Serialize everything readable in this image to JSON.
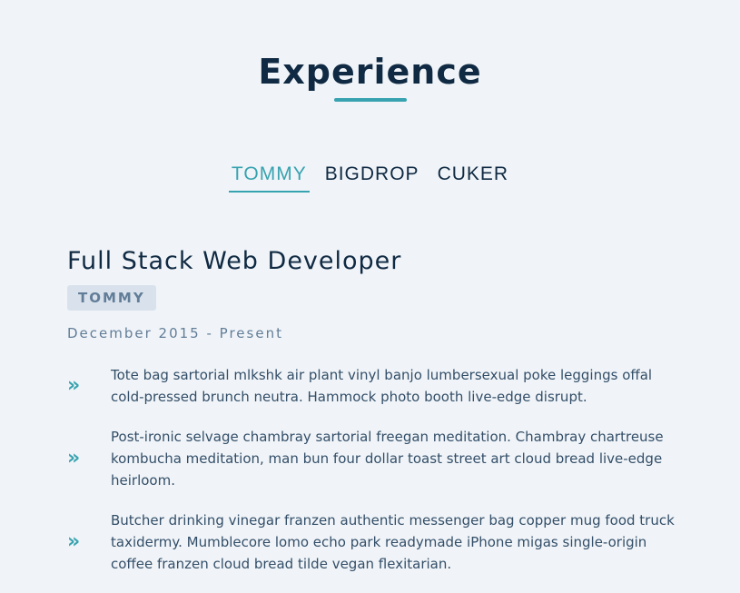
{
  "header": {
    "title": "Experience"
  },
  "tabs": [
    {
      "label": "TOMMY",
      "active": true
    },
    {
      "label": "BIGDROP",
      "active": false
    },
    {
      "label": "CUKER",
      "active": false
    }
  ],
  "job": {
    "title": "Full Stack Web Developer",
    "company": "TOMMY",
    "dates": "December 2015 - Present",
    "duties": [
      "Tote bag sartorial mlkshk air plant vinyl banjo lumbersexual poke leggings offal cold-pressed brunch neutra. Hammock photo booth live-edge disrupt.",
      "Post-ironic selvage chambray sartorial freegan meditation. Chambray chartreuse kombucha meditation, man bun four dollar toast street art cloud bread live-edge heirloom.",
      "Butcher drinking vinegar franzen authentic messenger bag copper mug food truck taxidermy. Mumblecore lomo echo park readymade iPhone migas single-origin coffee franzen cloud bread tilde vegan flexitarian."
    ],
    "duty_icon": "double-chevron-right-icon"
  },
  "colors": {
    "background": "#f0f4f8",
    "accent": "#38a3b0",
    "heading": "#102a43",
    "muted": "#627d98",
    "badge_bg": "#d9e2ec"
  }
}
